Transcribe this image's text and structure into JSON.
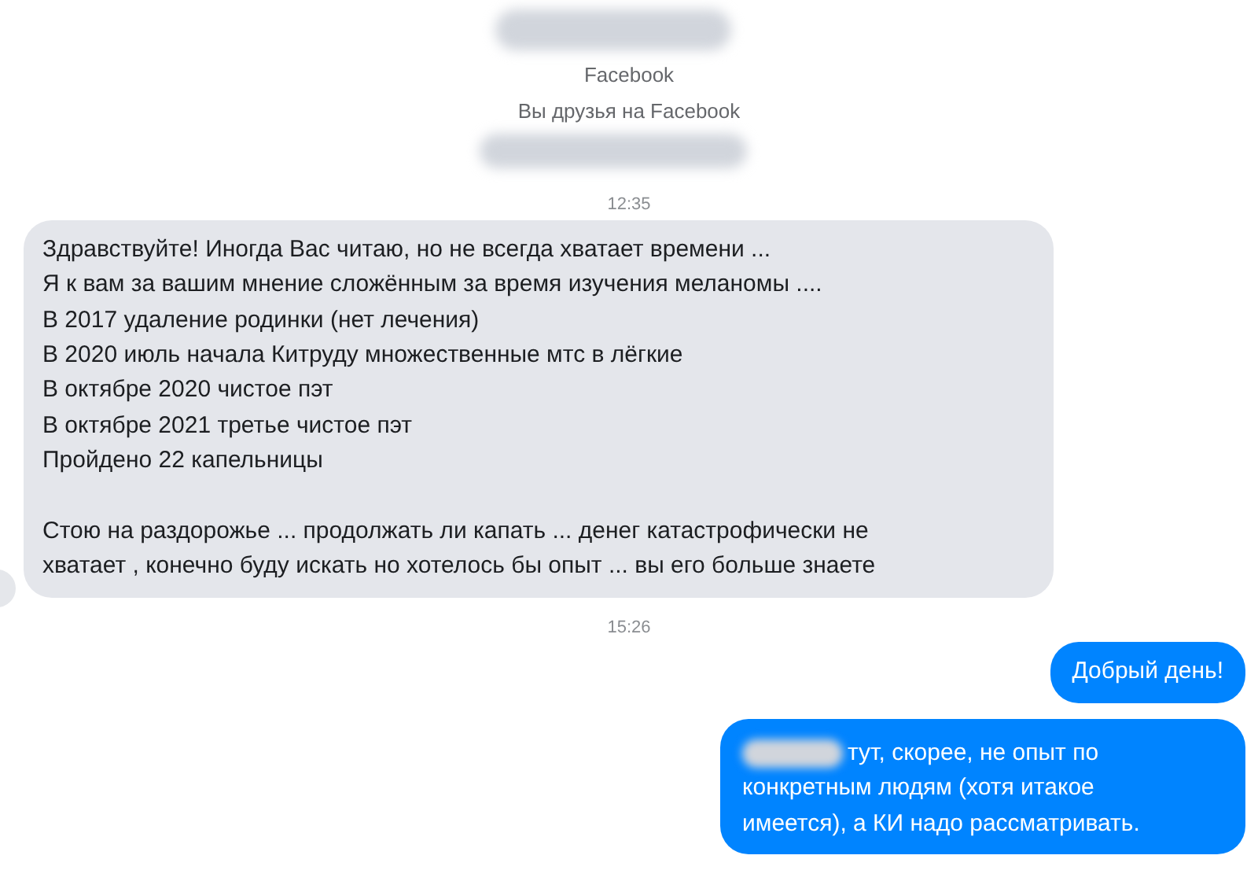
{
  "contact": {
    "source": "Facebook",
    "relation": "Вы друзья на Facebook"
  },
  "messages": [
    {
      "kind": "time",
      "text": "12:35"
    },
    {
      "kind": "incoming",
      "text": "Здравствуйте! Иногда Вас читаю, но не всегда хватает времени ...\nЯ к вам за вашим мнение сложённым за время изучения меланомы ....\nВ 2017 удаление родинки (нет лечения)\nВ 2020 июль начала Китруду множественные мтс в лёгкие\nВ октябре 2020 чистое пэт\nВ октябре 2021 третье чистое пэт\nПройдено 22 капельницы\n\nСтою на раздорожье ... продолжать ли капать ... денег катастрофически не\nхватает , конечно буду искать но хотелось бы опыт ... вы его больше знаете"
    },
    {
      "kind": "time",
      "text": "15:26"
    },
    {
      "kind": "outgoing",
      "text": "Добрый день!"
    },
    {
      "kind": "outgoing",
      "redacted_start": true,
      "text": "тут, скорее, не опыт по\nконкретным людям (хотя итакое\nимеется), а КИ надо рассматривать."
    }
  ]
}
